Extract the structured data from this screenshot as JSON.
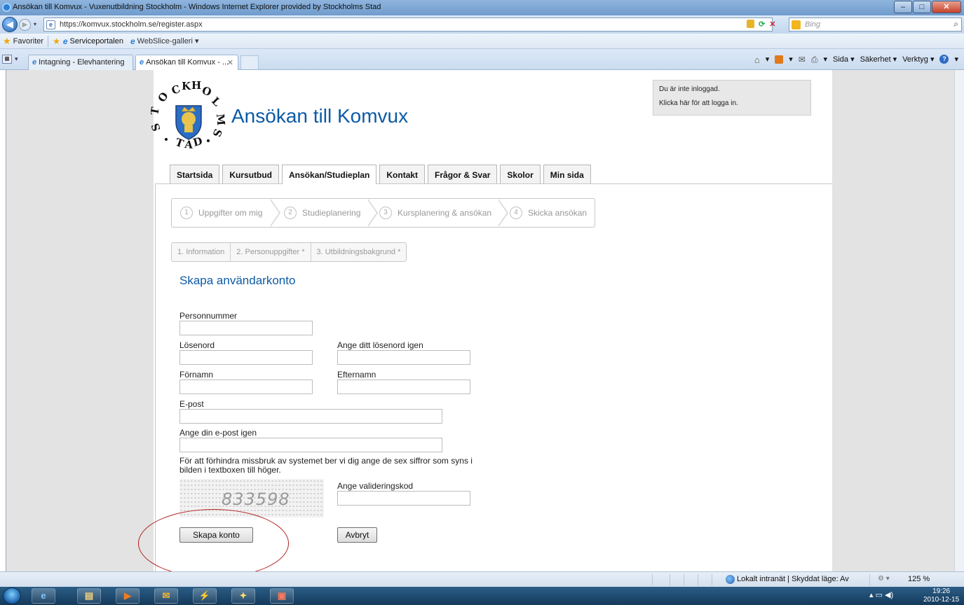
{
  "window": {
    "title": "Ansökan till Komvux - Vuxenutbildning Stockholm - Windows Internet Explorer provided by Stockholms Stad"
  },
  "address_bar": {
    "url": "https://komvux.stockholm.se/register.aspx",
    "search_placeholder": "Bing"
  },
  "favorites_bar": {
    "favorites_label": "Favoriter",
    "links": [
      "Serviceportalen",
      "WebSlice-galleri ▾"
    ]
  },
  "browser_tabs": [
    {
      "label": "Intagning - Elevhantering"
    },
    {
      "label": "Ansökan till Komvux - ..."
    }
  ],
  "command_bar": {
    "page_menu": "Sida ▾",
    "safety_menu": "Säkerhet ▾",
    "tools_menu": "Verktyg ▾"
  },
  "site": {
    "title": "Ansökan till Komvux",
    "logo_text": "STOCKHOLMS STAD"
  },
  "login_box": {
    "status": "Du är inte inloggad.",
    "link": "Klicka här för att logga in."
  },
  "nav_tabs": [
    "Startsida",
    "Kursutbud",
    "Ansökan/Studieplan",
    "Kontakt",
    "Frågor & Svar",
    "Skolor",
    "Min sida"
  ],
  "active_nav_tab": "Ansökan/Studieplan",
  "wizard_steps": [
    {
      "num": "1",
      "label": "Uppgifter om mig"
    },
    {
      "num": "2",
      "label": "Studieplanering"
    },
    {
      "num": "3",
      "label": "Kursplanering & ansökan"
    },
    {
      "num": "4",
      "label": "Skicka ansökan"
    }
  ],
  "sub_steps": [
    "1. Information",
    "2. Personuppgifter *",
    "3. Utbildningsbakgrund *"
  ],
  "form": {
    "heading": "Skapa användarkonto",
    "fields": {
      "personnummer": {
        "label": "Personnummer",
        "value": ""
      },
      "password": {
        "label": "Lösenord",
        "value": ""
      },
      "password_repeat": {
        "label": "Ange ditt lösenord igen",
        "value": ""
      },
      "first_name": {
        "label": "Förnamn",
        "value": ""
      },
      "last_name": {
        "label": "Efternamn",
        "value": ""
      },
      "email": {
        "label": "E-post",
        "value": ""
      },
      "email_repeat": {
        "label": "Ange din e-post igen",
        "value": ""
      },
      "validation_code": {
        "label": "Ange valideringskod",
        "value": ""
      }
    },
    "captcha_notice": "För att förhindra missbruk av systemet ber vi dig ange de sex siffror som syns i bilden i textboxen till höger.",
    "captcha_code": "833598",
    "submit_label": "Skapa konto",
    "cancel_label": "Avbryt"
  },
  "status_bar": {
    "zone": "Lokalt intranät | Skyddat läge: Av",
    "zoom": "125 %"
  },
  "taskbar": {
    "time": "19:26",
    "date": "2010-12-15"
  },
  "colors": {
    "accent_blue": "#0c5aa6",
    "annotation_red": "#b21e1e"
  }
}
